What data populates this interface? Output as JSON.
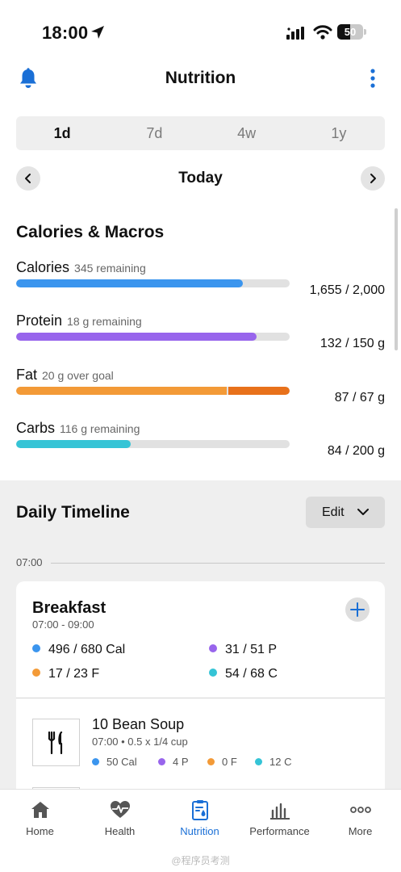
{
  "status": {
    "time": "18:00",
    "battery_text": "50",
    "battery_level": 0.5
  },
  "header": {
    "title": "Nutrition"
  },
  "period_tabs": [
    {
      "label": "1d",
      "active": true
    },
    {
      "label": "7d",
      "active": false
    },
    {
      "label": "4w",
      "active": false
    },
    {
      "label": "1y",
      "active": false
    }
  ],
  "date_nav": {
    "label": "Today"
  },
  "macros": {
    "title": "Calories & Macros",
    "items": [
      {
        "name": "Calories",
        "sub": "345 remaining",
        "value": "1,655 / 2,000",
        "progress": 0.8275,
        "over": 0,
        "color": "#3b95ee",
        "over_color": "#e8711b"
      },
      {
        "name": "Protein",
        "sub": "18 g remaining",
        "value": "132 / 150 g",
        "progress": 0.88,
        "over": 0,
        "color": "#9865ec",
        "over_color": "#e8711b"
      },
      {
        "name": "Fat",
        "sub": "20 g over goal",
        "value": "87 / 67 g",
        "progress": 0.77,
        "over": 0.23,
        "color": "#f39a37",
        "over_color": "#e8711b"
      },
      {
        "name": "Carbs",
        "sub": "116 g remaining",
        "value": "84 / 200 g",
        "progress": 0.42,
        "over": 0,
        "color": "#35c4d6",
        "over_color": "#e8711b"
      }
    ]
  },
  "timeline": {
    "title": "Daily Timeline",
    "edit_label": "Edit",
    "time_marker": "07:00"
  },
  "meal": {
    "name": "Breakfast",
    "time": "07:00 - 09:00",
    "stats": [
      {
        "text": "496 / 680 Cal",
        "color": "#3b95ee"
      },
      {
        "text": "31 / 51 P",
        "color": "#9865ec"
      },
      {
        "text": "17 / 23 F",
        "color": "#f39a37"
      },
      {
        "text": "54 / 68 C",
        "color": "#35c4d6"
      }
    ],
    "food": {
      "name": "10 Bean Soup",
      "detail": "07:00 • 0.5 x 1/4 cup",
      "stats": [
        {
          "text": "50 Cal",
          "color": "#3b95ee"
        },
        {
          "text": "4 P",
          "color": "#9865ec"
        },
        {
          "text": "0 F",
          "color": "#f39a37"
        },
        {
          "text": "12 C",
          "color": "#35c4d6"
        }
      ]
    }
  },
  "bottom_nav": [
    {
      "label": "Home",
      "icon": "home-icon",
      "active": false
    },
    {
      "label": "Health",
      "icon": "heart-pulse-icon",
      "active": false
    },
    {
      "label": "Nutrition",
      "icon": "clipboard-drop-icon",
      "active": true
    },
    {
      "label": "Performance",
      "icon": "bar-chart-icon",
      "active": false
    },
    {
      "label": "More",
      "icon": "more-horiz-icon",
      "active": false
    }
  ],
  "colors": {
    "accent": "#1a6fd6"
  },
  "watermark": "@程序员考测"
}
